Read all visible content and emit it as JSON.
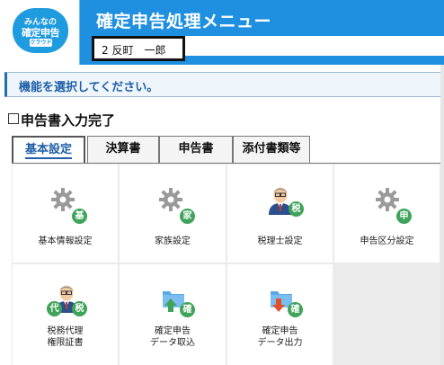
{
  "app": {
    "logo": {
      "line1": "みんなの",
      "line2": "確定申告",
      "line3": "クラウド"
    },
    "title": "確定申告処理メニュー",
    "user_name": "2 反町　一郎"
  },
  "instruction": "機能を選択してください。",
  "completion_checkbox": {
    "label": "申告書入力完了",
    "checked": false
  },
  "tabs": [
    {
      "label": "基本設定",
      "active": true
    },
    {
      "label": "決算書",
      "active": false
    },
    {
      "label": "申告書",
      "active": false
    },
    {
      "label": "添付書類等",
      "active": false
    }
  ],
  "menu_items": [
    {
      "label": "基本情報設定",
      "icon": "gear-icon",
      "badge": "基"
    },
    {
      "label": "家族設定",
      "icon": "gear-icon",
      "badge": "家"
    },
    {
      "label": "税理士設定",
      "icon": "person-icon",
      "badge": "税"
    },
    {
      "label": "申告区分設定",
      "icon": "gear-icon",
      "badge": "申"
    },
    {
      "label": "税務代理\n権限証書",
      "icon": "person-icon",
      "badge": "代",
      "badge2": "税"
    },
    {
      "label": "確定申告\nデータ取込",
      "icon": "folder-import-icon",
      "badge": "確"
    },
    {
      "label": "確定申告\nデータ出力",
      "icon": "folder-export-icon",
      "badge": "確"
    }
  ],
  "colors": {
    "header_blue": "#1f8fe0",
    "badge_green": "#3fa35a",
    "instruction_text": "#1f5fa8",
    "arrow_green": "#3fa35a",
    "arrow_red": "#e0502c",
    "folder_blue": "#5aa9e6"
  }
}
